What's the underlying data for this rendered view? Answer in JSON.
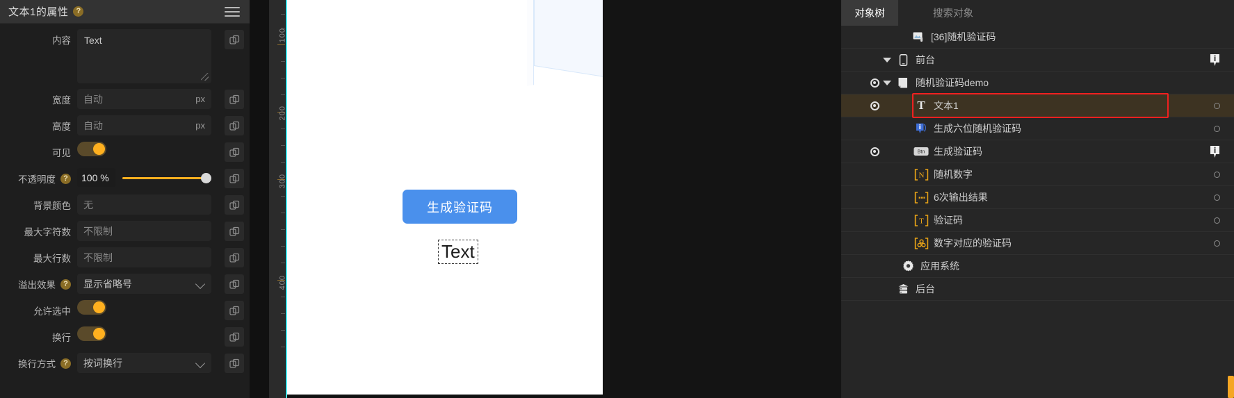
{
  "left_panel": {
    "title": "文本1的属性",
    "help_glyph": "?",
    "menu_icon": "hamburger-icon",
    "rows": [
      {
        "label": "内容",
        "type": "textarea",
        "value": "Text",
        "copy": true,
        "help": false
      },
      {
        "label": "宽度",
        "type": "input",
        "value": "自动",
        "unit": "px",
        "copy": true,
        "help": false
      },
      {
        "label": "高度",
        "type": "input",
        "value": "自动",
        "unit": "px",
        "copy": true,
        "help": false
      },
      {
        "label": "可见",
        "type": "toggle",
        "value": "on",
        "copy": true,
        "help": false
      },
      {
        "label": "不透明度",
        "type": "opacity",
        "value": "100 %",
        "percent": 100,
        "copy": true,
        "help": true
      },
      {
        "label": "背景颜色",
        "type": "input",
        "value": "无",
        "unit": "",
        "copy": true,
        "help": false
      },
      {
        "label": "最大字符数",
        "type": "input",
        "value": "不限制",
        "unit": "",
        "copy": true,
        "help": false
      },
      {
        "label": "最大行数",
        "type": "input",
        "value": "不限制",
        "unit": "",
        "copy": true,
        "help": false
      },
      {
        "label": "溢出效果",
        "type": "select",
        "value": "显示省略号",
        "copy": true,
        "help": true
      },
      {
        "label": "允许选中",
        "type": "toggle",
        "value": "on",
        "copy": true,
        "help": false
      },
      {
        "label": "换行",
        "type": "toggle",
        "value": "on",
        "copy": true,
        "help": false
      },
      {
        "label": "换行方式",
        "type": "select",
        "value": "按词换行",
        "copy": true,
        "help": true
      }
    ]
  },
  "canvas": {
    "ruler_labels": [
      "100",
      "200",
      "300",
      "400"
    ],
    "button_label": "生成验证码",
    "text_element_label": "Text",
    "accent_button_color": "#4a90ec",
    "guide_color": "#46e8f0"
  },
  "right_panel": {
    "tabs": [
      {
        "label": "对象树",
        "active": true
      },
      {
        "label": "搜索对象",
        "active": false
      }
    ],
    "tree": [
      {
        "label": "[36]随机验证码",
        "icon": "image-module-icon",
        "indent": 0,
        "eye": false,
        "caret": "none",
        "end": "none",
        "selected": false
      },
      {
        "label": "前台",
        "icon": "phone-icon",
        "indent": 1,
        "eye": false,
        "caret": "down",
        "end": "info",
        "selected": false
      },
      {
        "label": "随机验证码demo",
        "icon": "page-icon",
        "indent": 2,
        "eye": true,
        "caret": "down",
        "end": "none",
        "selected": false
      },
      {
        "label": "文本1",
        "icon": "text-T-icon",
        "indent": 3,
        "eye": true,
        "caret": "none",
        "end": "circle",
        "selected": true
      },
      {
        "label": "生成六位随机验证码",
        "icon": "blue-info-icon",
        "indent": 3,
        "eye": false,
        "caret": "none",
        "end": "circle",
        "selected": false
      },
      {
        "label": "生成验证码",
        "icon": "btn-icon",
        "indent": 3,
        "eye": true,
        "caret": "none",
        "end": "info",
        "selected": false
      },
      {
        "label": "随机数字",
        "icon": "variable-N-icon",
        "indent": 3,
        "eye": false,
        "caret": "none",
        "end": "circle",
        "selected": false
      },
      {
        "label": "6次输出结果",
        "icon": "array-icon",
        "indent": 3,
        "eye": false,
        "caret": "none",
        "end": "circle",
        "selected": false
      },
      {
        "label": "验证码",
        "icon": "variable-T-icon",
        "indent": 3,
        "eye": false,
        "caret": "none",
        "end": "circle",
        "selected": false
      },
      {
        "label": "数字对应的验证码",
        "icon": "object-icon",
        "indent": 3,
        "eye": false,
        "caret": "none",
        "end": "circle",
        "selected": false
      },
      {
        "label": "应用系统",
        "icon": "gear-icon",
        "indent": 2,
        "eye": false,
        "caret": "none",
        "end": "none",
        "selected": false
      },
      {
        "label": "后台",
        "icon": "server-icon",
        "indent": 1,
        "eye": false,
        "caret": "none",
        "end": "none",
        "selected": false
      }
    ],
    "selection_highlight_color": "#f02020",
    "scrollbar_color": "#f5a623"
  }
}
